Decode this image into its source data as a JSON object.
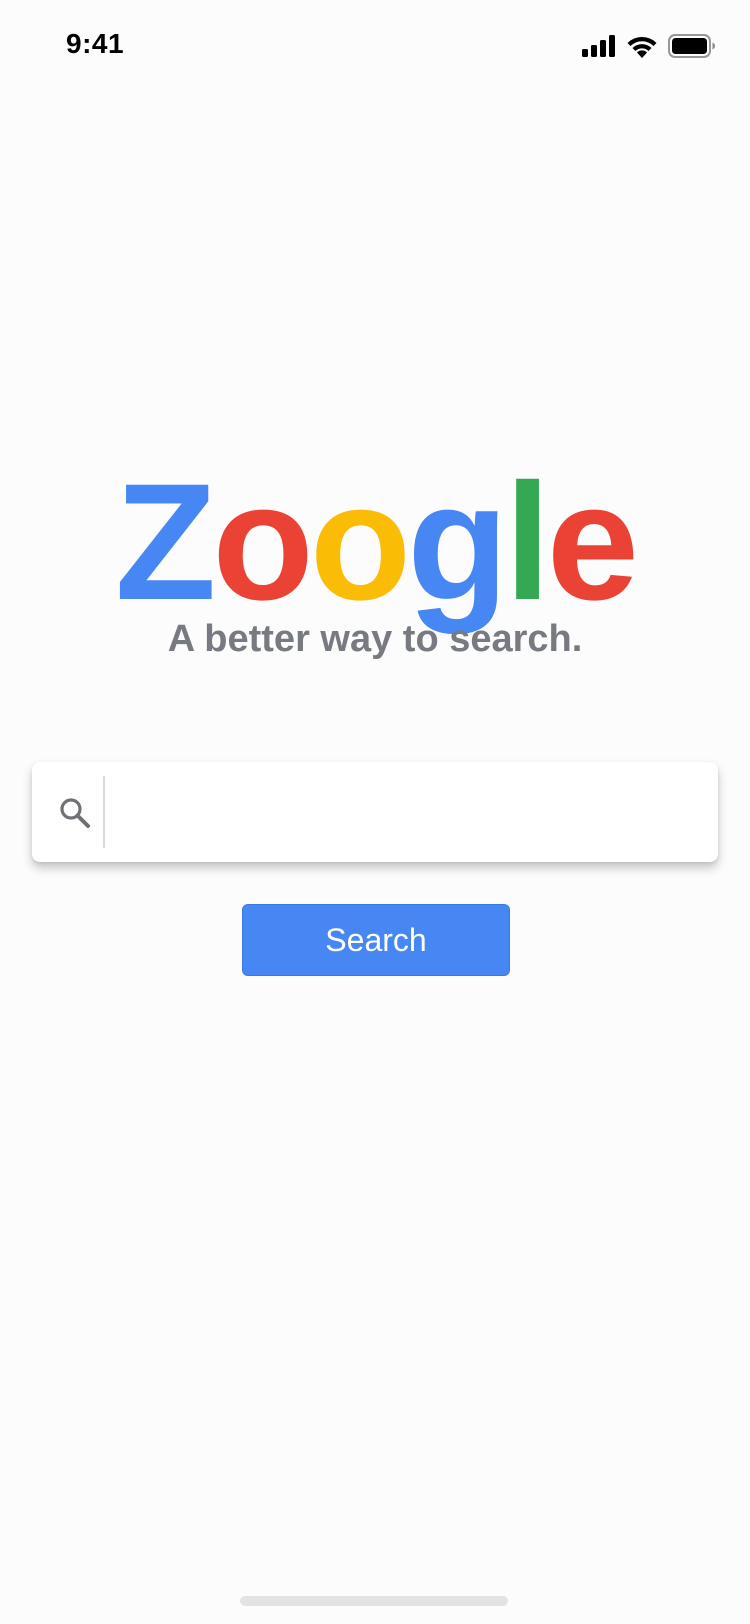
{
  "status_bar": {
    "time": "9:41",
    "icons": [
      "cellular-signal-icon",
      "wifi-icon",
      "battery-icon"
    ]
  },
  "logo": {
    "letters": [
      {
        "char": "Z",
        "color": "#4787f4"
      },
      {
        "char": "o",
        "color": "#ea4335"
      },
      {
        "char": "o",
        "color": "#fbbc05"
      },
      {
        "char": "g",
        "color": "#4787f4"
      },
      {
        "char": "l",
        "color": "#34a853"
      },
      {
        "char": "e",
        "color": "#ea4335"
      }
    ]
  },
  "tagline": "A better way to search.",
  "search": {
    "value": "",
    "placeholder": "",
    "icon": "search-icon",
    "button_label": "Search"
  },
  "colors": {
    "accent": "#4787f4",
    "background": "#fcfcfc",
    "tagline_text": "#777a80"
  }
}
